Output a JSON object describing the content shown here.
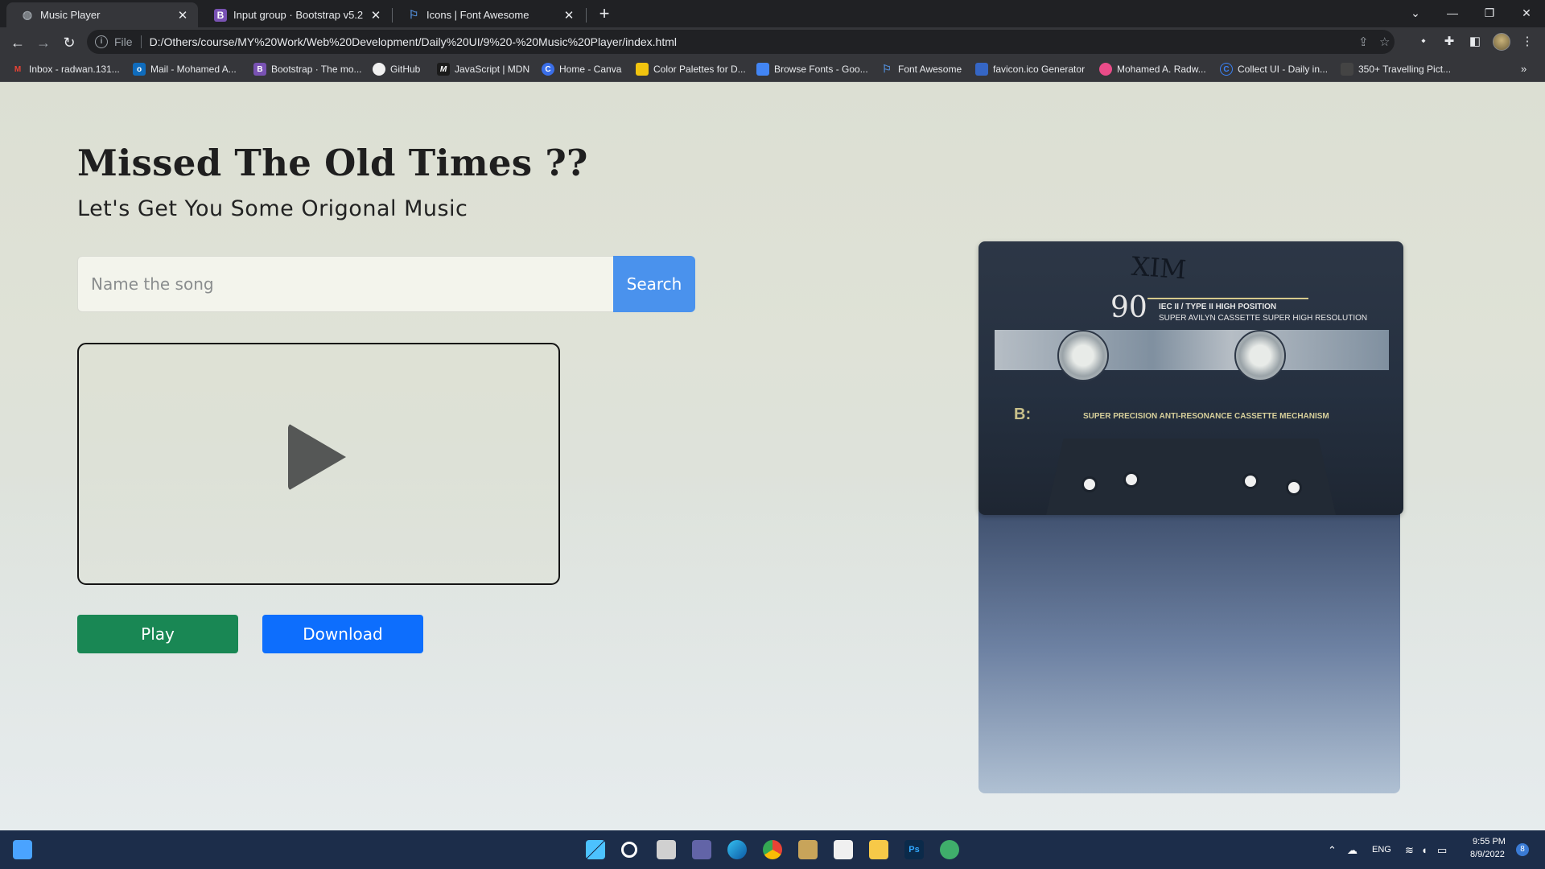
{
  "browser": {
    "tabs": [
      {
        "title": "Music Player",
        "favicon": "globe-icon",
        "active": true
      },
      {
        "title": "Input group · Bootstrap v5.2",
        "favicon": "bootstrap-icon",
        "active": false
      },
      {
        "title": "Icons | Font Awesome",
        "favicon": "flag-icon",
        "active": false
      }
    ],
    "new_tab": "+",
    "scheme": "File",
    "url": "D:/Others/course/MY%20Work/Web%20Development/Daily%20UI/9%20-%20Music%20Player/index.html",
    "bookmarks": [
      {
        "label": "Inbox - radwan.131...",
        "icon": "gmail-icon",
        "color": "#ea4335",
        "glyph": "M"
      },
      {
        "label": "Mail - Mohamed A...",
        "icon": "outlook-icon",
        "color": "#0f6cbd",
        "glyph": "o"
      },
      {
        "label": "Bootstrap · The mo...",
        "icon": "bootstrap-icon",
        "color": "#7952b3",
        "glyph": "B"
      },
      {
        "label": "GitHub",
        "icon": "github-icon",
        "color": "#f0f0f0",
        "glyph": ""
      },
      {
        "label": "JavaScript | MDN",
        "icon": "mdn-icon",
        "color": "#1b1b1b",
        "glyph": "M"
      },
      {
        "label": "Home - Canva",
        "icon": "canva-icon",
        "color": "#3a6ee8",
        "glyph": "C"
      },
      {
        "label": "Color Palettes for D...",
        "icon": "palette-icon",
        "color": "#f1c40f",
        "glyph": ""
      },
      {
        "label": "Browse Fonts - Goo...",
        "icon": "google-fonts-icon",
        "color": "#4285f4",
        "glyph": ""
      },
      {
        "label": "Font Awesome",
        "icon": "flag-icon",
        "color": "#528dd7",
        "glyph": ""
      },
      {
        "label": "favicon.ico Generator",
        "icon": "favicon-icon",
        "color": "#3566c5",
        "glyph": ""
      },
      {
        "label": "Mohamed A. Radw...",
        "icon": "dribbble-icon",
        "color": "#ea4c89",
        "glyph": ""
      },
      {
        "label": "Collect UI - Daily in...",
        "icon": "collectui-icon",
        "color": "#3b82f6",
        "glyph": "C"
      },
      {
        "label": "350+ Travelling Pict...",
        "icon": "folder-icon",
        "color": "#444444",
        "glyph": ""
      }
    ],
    "more": "»"
  },
  "page": {
    "title": "Missed The Old Times ??",
    "subtitle": "Let's Get You Some Origonal Music",
    "search": {
      "placeholder": "Name the song",
      "value": "",
      "button": "Search"
    },
    "player": {
      "icon": "play-icon"
    },
    "buttons": {
      "play": "Play",
      "download": "Download"
    },
    "colors": {
      "play": "#198754",
      "download": "#0d6efd",
      "search": "#4a92ed"
    }
  },
  "cassette_image": {
    "handwritten": "XIM",
    "length": "90",
    "line1": "IEC II / TYPE II HIGH POSITION",
    "line2": "SUPER AVILYN CASSETTE SUPER HIGH RESOLUTION",
    "side": "B:",
    "line3": "SUPER PRECISION ANTI-RESONANCE CASSETTE MECHANISM"
  },
  "taskbar": {
    "lang": "ENG",
    "time": "9:55 PM",
    "date": "8/9/2022",
    "notifications": "8"
  }
}
